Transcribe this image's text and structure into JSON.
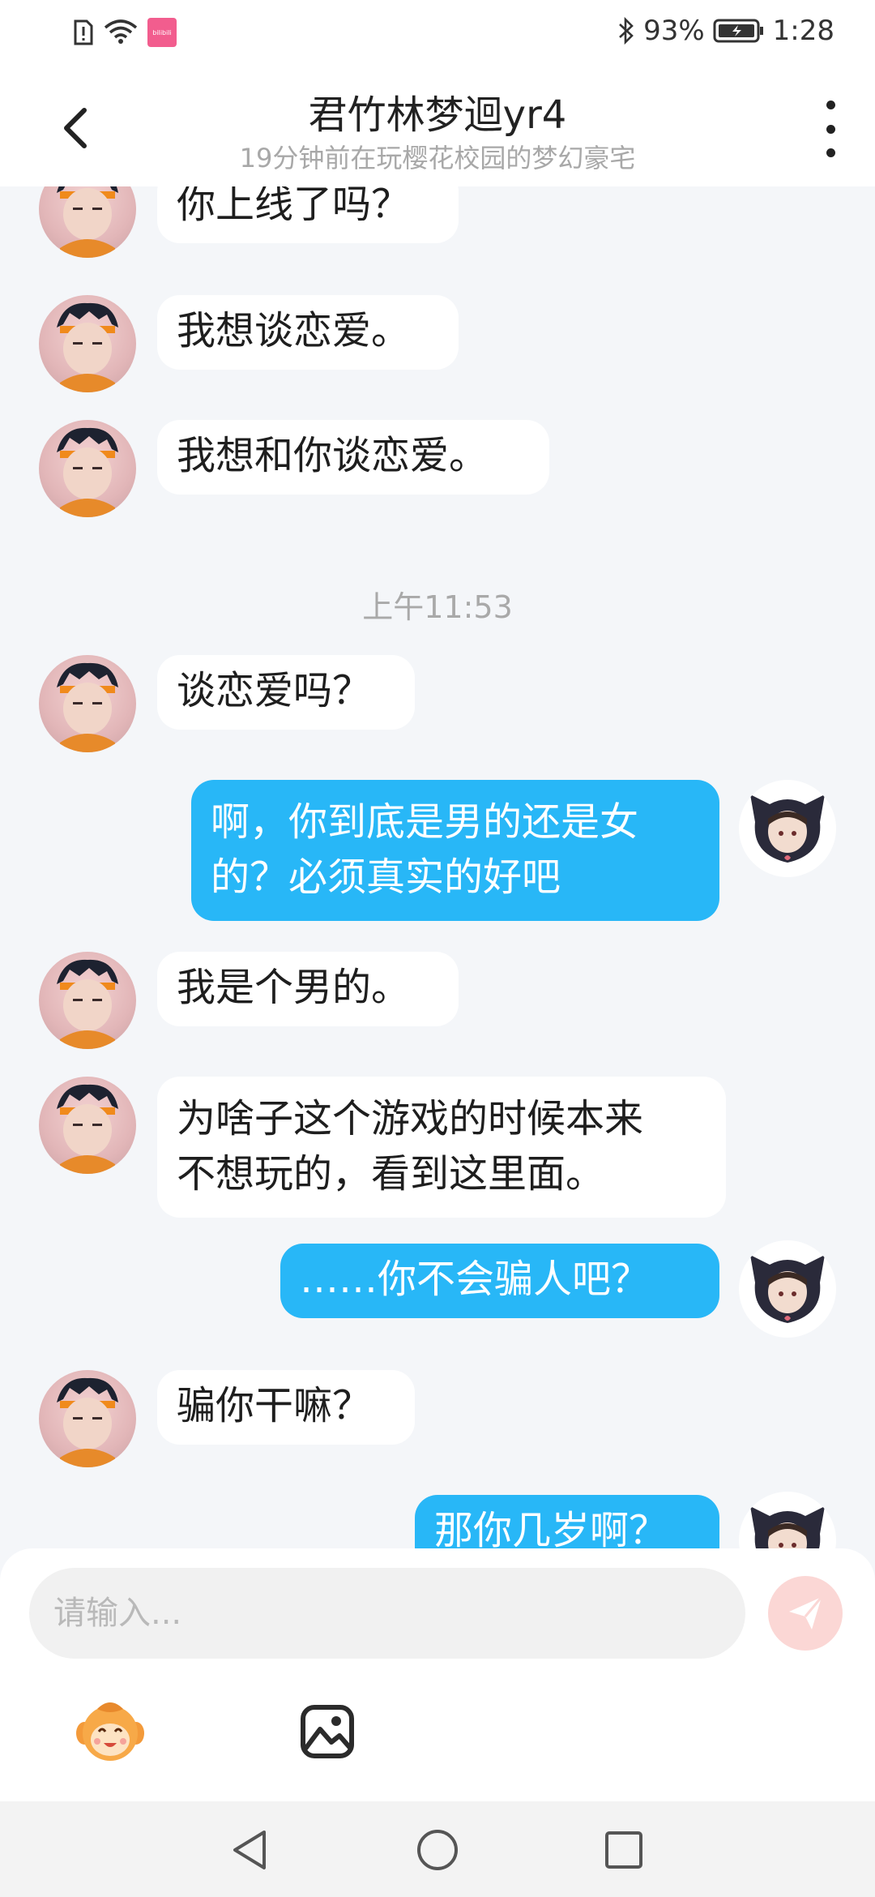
{
  "status_bar": {
    "battery": "93%",
    "time": "1:28",
    "notification_badge": "bilibili"
  },
  "header": {
    "title": "君竹林梦迴yr4",
    "subtitle": "19分钟前在玩樱花校园的梦幻豪宅"
  },
  "messages": [
    {
      "from": "other",
      "lines": [
        "你上线了吗？"
      ]
    },
    {
      "from": "other",
      "lines": [
        "我想谈恋爱。"
      ]
    },
    {
      "from": "other",
      "lines": [
        "我想和你谈恋爱。"
      ]
    },
    {
      "type": "time",
      "text": "上午11:53"
    },
    {
      "from": "other",
      "lines": [
        "谈恋爱吗？"
      ]
    },
    {
      "from": "self",
      "lines": [
        "啊，你到底是男的还是女",
        "的？必须真实的好吧"
      ]
    },
    {
      "from": "other",
      "lines": [
        "我是个男的。"
      ]
    },
    {
      "from": "other",
      "lines": [
        "为啥子这个游戏的时候本来",
        "不想玩的，看到这里面。"
      ]
    },
    {
      "from": "self",
      "lines": [
        "……你不会骗人吧？"
      ]
    },
    {
      "from": "other",
      "lines": [
        "骗你干嘛？"
      ]
    },
    {
      "from": "self",
      "lines": [
        "那你几岁啊？"
      ]
    }
  ],
  "composer": {
    "placeholder": "请输入..."
  },
  "colors": {
    "outgoing_bubble": "#28b7f7",
    "incoming_bubble": "#ffffff",
    "chat_background": "#f4f6f9",
    "send_button": "#fbd7d5"
  },
  "icons": {
    "back": "chevron-left-icon",
    "more": "more-vertical-icon",
    "send": "paper-plane-icon",
    "emoji": "mascot-face-icon",
    "image": "image-icon"
  }
}
